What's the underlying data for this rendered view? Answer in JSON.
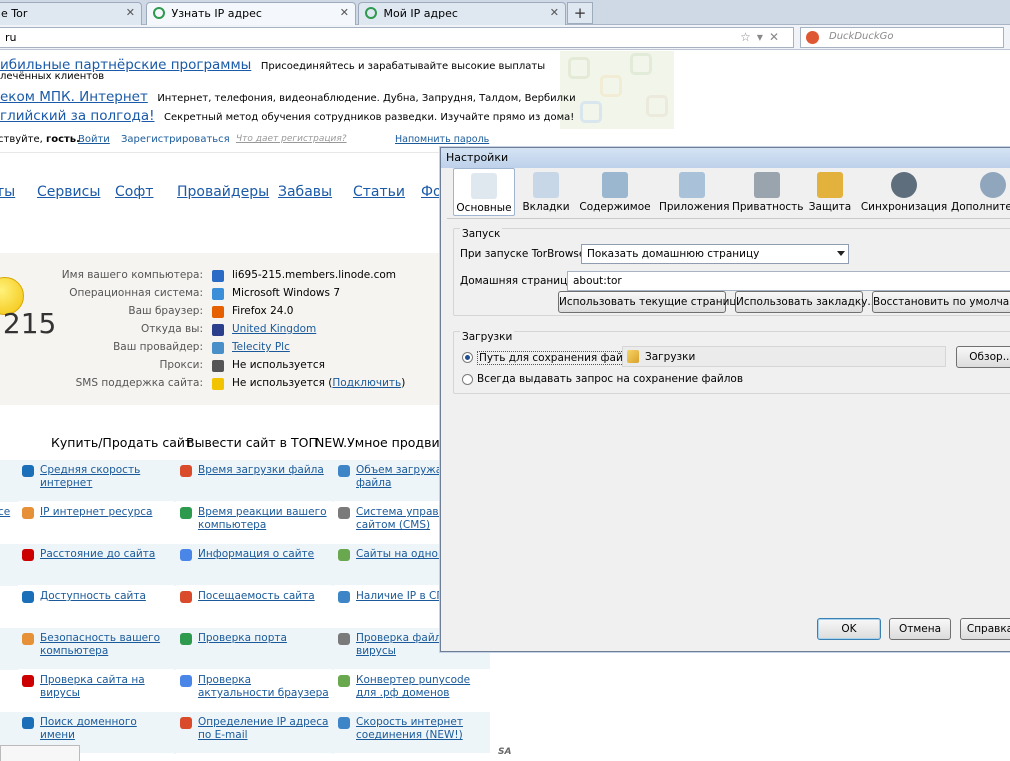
{
  "tabs": [
    {
      "title": "e Tor"
    },
    {
      "title": "Узнать IP адрес"
    },
    {
      "title": "Мой IP адрес"
    }
  ],
  "url": {
    "value": "ru"
  },
  "search": {
    "placeholder": "DuckDuckGo"
  },
  "ads": [
    {
      "link": "ибильные партнёрские программы",
      "text": "Присоединяйтесь и зарабатывайте высокие выплаты",
      "text2": "лечённых клиентов"
    },
    {
      "link": "еком МПК. Интернет",
      "text": "Интернет, телефония, видеонаблюдение. Дубна, Запрудня, Талдом, Вербилки"
    },
    {
      "link": "глийский за полгода!",
      "text": "Секретный метод обучения сотрудников разведки. Изучайте прямо из дома!"
    }
  ],
  "login": {
    "greeting": "ствуйте,",
    "guest": "гость.",
    "login": "Войти",
    "register": "Зарегистрироваться",
    "why": "Что дает регистрация?",
    "remind": "Напомнить пароль"
  },
  "menu": [
    "ты",
    "Сервисы",
    "Софт",
    "Провайдеры",
    "Забавы",
    "Статьи",
    "Фо"
  ],
  "ip": {
    "shown": ".215"
  },
  "info": [
    {
      "label": "Имя вашего компьютера:",
      "value": "li695-215.members.linode.com",
      "icon": "network-icon",
      "link": false
    },
    {
      "label": "Операционная система:",
      "value": "Microsoft Windows 7",
      "icon": "windows-icon",
      "link": false
    },
    {
      "label": "Ваш браузер:",
      "value": "Firefox 24.0",
      "icon": "firefox-icon",
      "link": false
    },
    {
      "label": "Откуда вы:",
      "value": "United Kingdom",
      "icon": "uk-flag-icon",
      "link": true
    },
    {
      "label": "Ваш провайдер:",
      "value": "Telecity Plc",
      "icon": "provider-icon",
      "link": true
    },
    {
      "label": "Прокси:",
      "value": "Не используется",
      "icon": "glasses-icon",
      "link": false
    },
    {
      "label": "SMS поддержка сайта:",
      "value": "Не используется",
      "icon": "warning-icon",
      "link": false,
      "extra": "Подключить"
    }
  ],
  "toolsbar": [
    "Купить/Продать сайт",
    "Вывести сайт в ТОП",
    "NEW.Умное продвижен"
  ],
  "grid": [
    [
      "",
      "Средняя скорость интернет",
      "Время загрузки файла",
      "Объем загружаем файла"
    ],
    [
      "се",
      "IP интернет ресурса",
      "Время реакции вашего компьютера",
      "Система управлен сайтом (CMS)"
    ],
    [
      "",
      "Расстояние до сайта",
      "Информация о сайте",
      "Сайты на одном I"
    ],
    [
      "",
      "Доступность сайта",
      "Посещаемость сайта",
      "Наличие IP в СПА"
    ],
    [
      "",
      "Безопасность вашего компьютера",
      "Проверка порта",
      "Проверка файла н вирусы"
    ],
    [
      "",
      "Проверка сайта на вирусы",
      "Проверка актуальности браузера",
      "Конвертер punycode для .рф доменов"
    ],
    [
      "",
      "Поиск доменного имени",
      "Определение IP адреса по E-mail",
      "Скорость интернет соединения (NEW!)"
    ]
  ],
  "watermark": "SA",
  "dialog": {
    "title": "Настройки",
    "toolbar": [
      "Основные",
      "Вкладки",
      "Содержимое",
      "Приложения",
      "Приватность",
      "Защита",
      "Синхронизация",
      "Дополнительные"
    ],
    "startup": {
      "group": "Запуск",
      "when_label": "При запуске TorBrowser:",
      "when_value": "Показать домашнюю страницу",
      "home_label": "Домашняя страница:",
      "home_value": "about:tor",
      "btn_current": "Использовать текущие страницы",
      "btn_bookmark": "Использовать закладку...",
      "btn_default": "Восстановить по умолчанию"
    },
    "downloads": {
      "group": "Загрузки",
      "save_to": "Путь для сохранения файлов",
      "folder": "Загрузки",
      "browse": "Обзор...",
      "always_ask": "Всегда выдавать запрос на сохранение файлов"
    },
    "ok": "OK",
    "cancel": "Отмена",
    "help": "Справка"
  }
}
